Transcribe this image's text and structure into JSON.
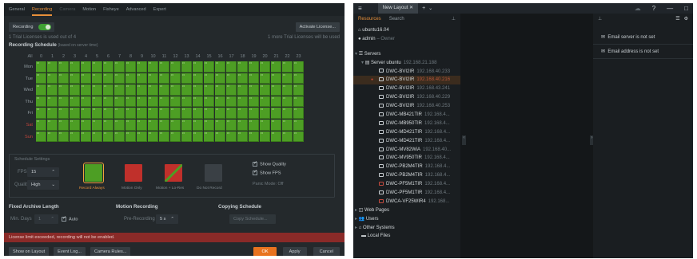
{
  "left": {
    "tabs": [
      "General",
      "Recording",
      "Camera",
      "Motion",
      "Fisheye",
      "Advanced",
      "Expert"
    ],
    "recording_label": "Recording",
    "activate_button": "Activate License...",
    "license_left": "1 Trial Licenses is used out of 4",
    "license_right": "1 more Trial Licenses will be used",
    "schedule_title": "Recording Schedule",
    "schedule_hint": "(based on server time)",
    "all_label": "All",
    "hours": [
      "0",
      "1",
      "2",
      "3",
      "4",
      "5",
      "6",
      "7",
      "8",
      "9",
      "10",
      "11",
      "12",
      "13",
      "14",
      "15",
      "16",
      "17",
      "18",
      "19",
      "20",
      "21",
      "22",
      "23"
    ],
    "days": [
      "Mon",
      "Tue",
      "Wed",
      "Thu",
      "Fri",
      "Sat",
      "Sun"
    ],
    "cell_text": "15",
    "settings_title": "Schedule Settings",
    "fps_label": "FPS",
    "fps_value": "15",
    "quality_label": "Quality",
    "quality_value": "High",
    "modes": [
      "Record Always",
      "Motion Only",
      "Motion + Lo-Res",
      "Do Not Record"
    ],
    "show_quality": "Show Quality",
    "show_fps": "Show FPS",
    "panic": "Panic Mode: Off",
    "archive_title": "Fixed Archive Length",
    "min_days_label": "Min. Days",
    "min_days_value": "1",
    "auto_label": "Auto",
    "motion_title": "Motion Recording",
    "pre_label": "Pre-Recording",
    "pre_value": "5 s",
    "copy_title": "Copying Schedule",
    "copy_button": "Copy Schedule...",
    "error": "License limit exceeded, recording will not be enabled.",
    "footer_buttons": [
      "Show on Layout",
      "Event Log...",
      "Camera Rules..."
    ],
    "ok": "OK",
    "apply": "Apply",
    "cancel": "Cancel",
    "colors": {
      "green": "#4d9e24",
      "accent": "#e8903a",
      "error": "#8a2a28"
    }
  },
  "right": {
    "layout_tab": "New Layout",
    "tab_resources": "Resources",
    "tab_search": "Search",
    "server_name": "ubuntu16.04",
    "user": "admin",
    "role": "Owner",
    "servers_label": "Servers",
    "server_row": {
      "name": "Server ubuntu",
      "ip": "192.168.21.188"
    },
    "cameras": [
      {
        "name": "DWC-BVI2IR",
        "ip": "192.168.40.233",
        "state": "ok"
      },
      {
        "name": "DWC-BVI2IR",
        "ip": "192.168.40.216",
        "state": "selected"
      },
      {
        "name": "DWC-BVI2IR",
        "ip": "192.168.43.241",
        "state": "ok"
      },
      {
        "name": "DWC-BVI2IR",
        "ip": "192.168.40.229",
        "state": "ok"
      },
      {
        "name": "DWC-BVI2IR",
        "ip": "192.168.40.253",
        "state": "ok"
      },
      {
        "name": "DWC-MB421TIR",
        "ip": "192.168.4...",
        "state": "ok"
      },
      {
        "name": "DWC-MB950TIR",
        "ip": "192.168.4...",
        "state": "ok"
      },
      {
        "name": "DWC-MD421TIR",
        "ip": "192.168.4...",
        "state": "ok"
      },
      {
        "name": "DWC-MD421TIR",
        "ip": "192.168.4...",
        "state": "ok"
      },
      {
        "name": "DWC-MV82WiA",
        "ip": "192.168.40...",
        "state": "ok"
      },
      {
        "name": "DWC-MV950TIR",
        "ip": "192.168.4...",
        "state": "ok"
      },
      {
        "name": "DWC-PB2M4TIR",
        "ip": "192.168.4...",
        "state": "ok"
      },
      {
        "name": "DWC-PB2M4TIR",
        "ip": "192.168.4...",
        "state": "ok"
      },
      {
        "name": "DWC-PF5M1TIR",
        "ip": "192.168.4...",
        "state": "bad"
      },
      {
        "name": "DWC-PF5M1TIR",
        "ip": "192.168.4...",
        "state": "ok"
      },
      {
        "name": "DWCA-VF25WIR4",
        "ip": "192.168...",
        "state": "bad"
      }
    ],
    "groups": [
      "Web Pages",
      "Users",
      "Other Systems",
      "Local Files"
    ],
    "notifications": [
      "Email server is not set",
      "Email address is not set"
    ]
  }
}
